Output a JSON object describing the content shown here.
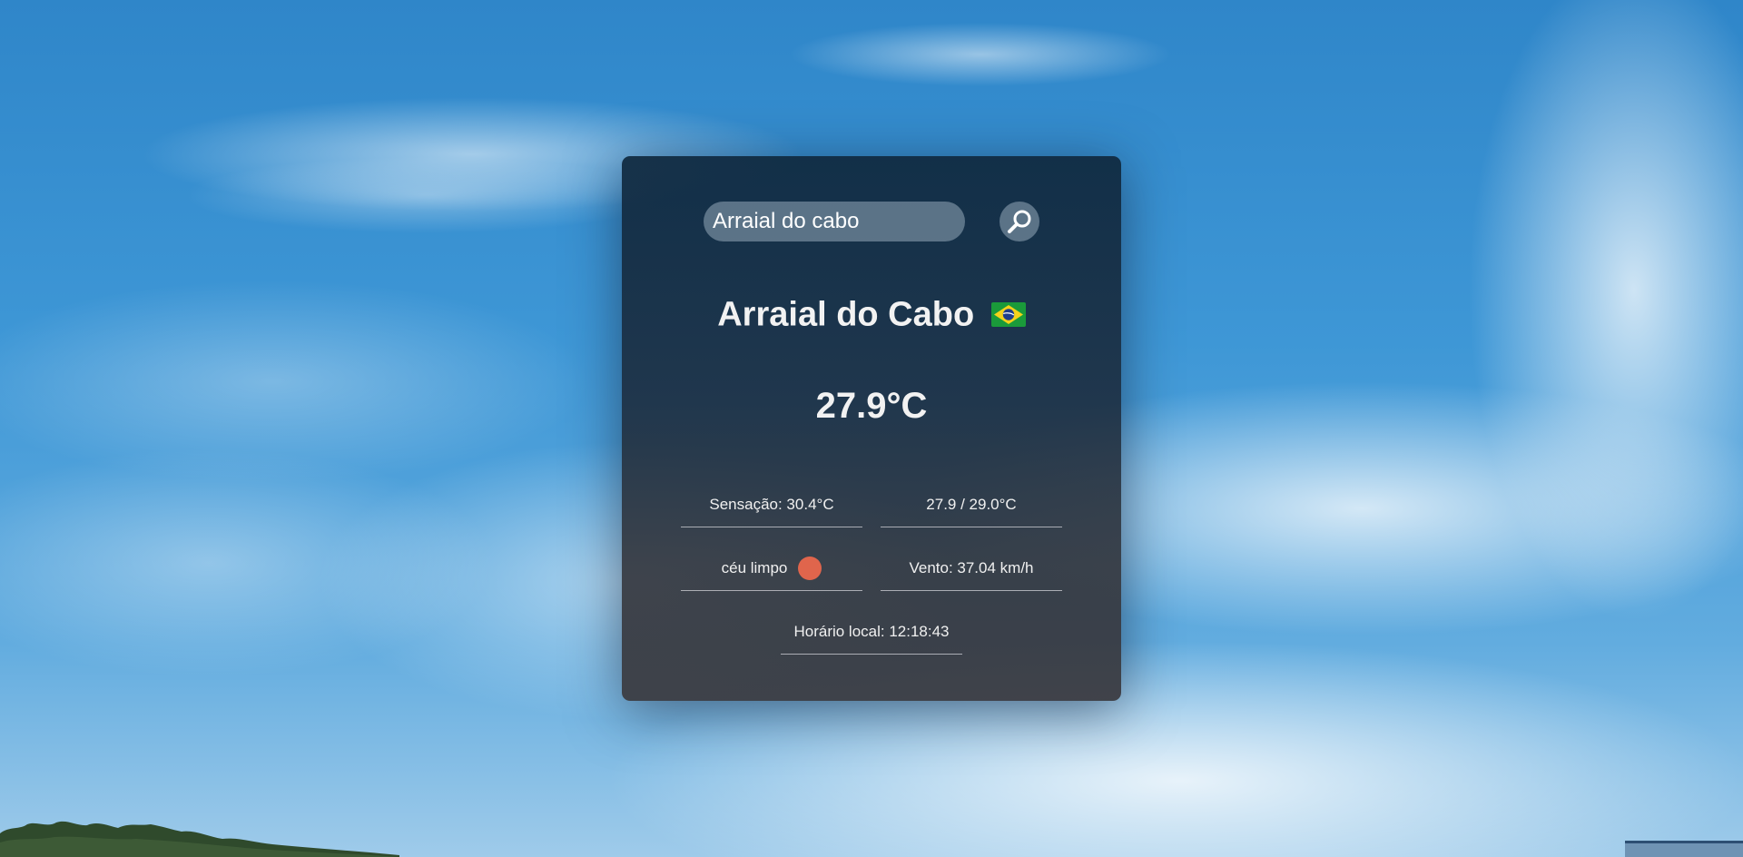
{
  "search": {
    "value": "Arraial do cabo",
    "placeholder": ""
  },
  "weather": {
    "city": "Arraial do Cabo",
    "country_flag": "brazil-flag-icon",
    "temperature": "27.9°C",
    "feels_like": "Sensação: 30.4°C",
    "min_max": "27.9 / 29.0°C",
    "description": "céu limpo",
    "weather_icon": "clear-sky-icon",
    "wind": "Vento: 37.04 km/h",
    "local_time": "Horário local: 12:18:43"
  },
  "colors": {
    "weather_icon": "#e0654c",
    "flag_green": "#1a9a3a",
    "flag_yellow": "#f5d21a",
    "flag_blue": "#1f3d8a"
  }
}
